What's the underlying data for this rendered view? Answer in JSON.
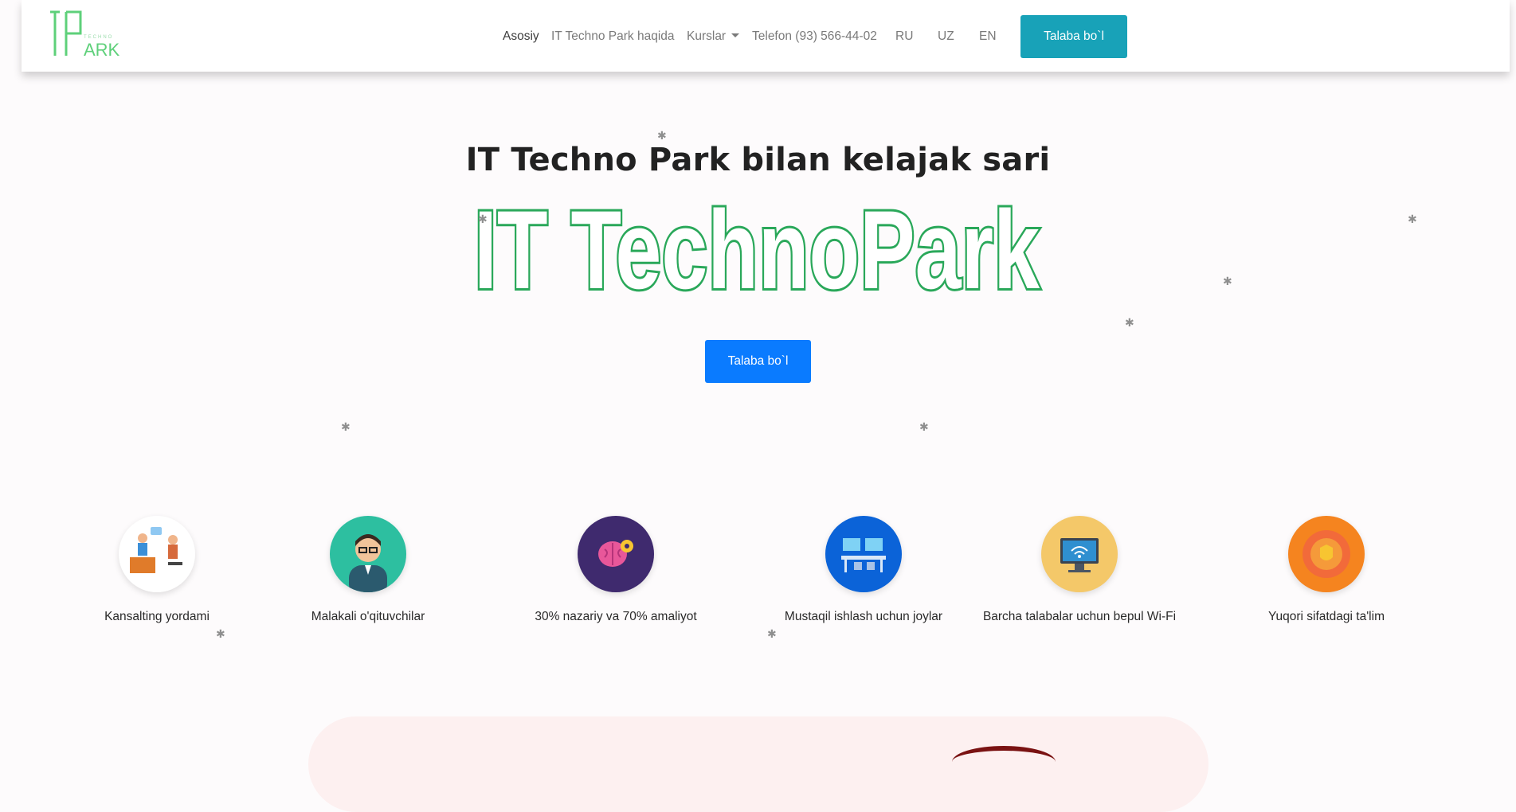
{
  "nav": {
    "logo_text": "ITPARK",
    "links": [
      {
        "label": "Asosiy",
        "active": true
      },
      {
        "label": "IT Techno Park haqida",
        "active": false
      },
      {
        "label": "Kurslar",
        "active": false
      },
      {
        "label": "Telefon (93) 566-44-02",
        "active": false
      },
      {
        "label": "RU",
        "active": false
      },
      {
        "label": "UZ",
        "active": false
      },
      {
        "label": "EN",
        "active": false
      }
    ],
    "cta_label": "Talaba bo`l"
  },
  "hero": {
    "title": "IT Techno Park bilan kelajak sari",
    "logo_text": "IT TechnoPark",
    "cta_label": "Talaba bo`l"
  },
  "features": [
    {
      "label": "Kansalting yordami",
      "icon": "consulting-icon"
    },
    {
      "label": "Malakali o'qituvchilar",
      "icon": "teacher-icon"
    },
    {
      "label": "30% nazariy va 70% amaliyot",
      "icon": "brain-icon"
    },
    {
      "label": "Mustaqil ishlash uchun joylar",
      "icon": "workplace-icon"
    },
    {
      "label": "Barcha talabalar uchun bepul Wi-Fi",
      "icon": "wifi-monitor-icon"
    },
    {
      "label": "Yuqori sifatdagi ta'lim",
      "icon": "quality-badge-icon"
    }
  ],
  "colors": {
    "brand_green": "#2aa85a",
    "nav_button": "#18a2b8",
    "hero_button": "#0a7bff"
  }
}
